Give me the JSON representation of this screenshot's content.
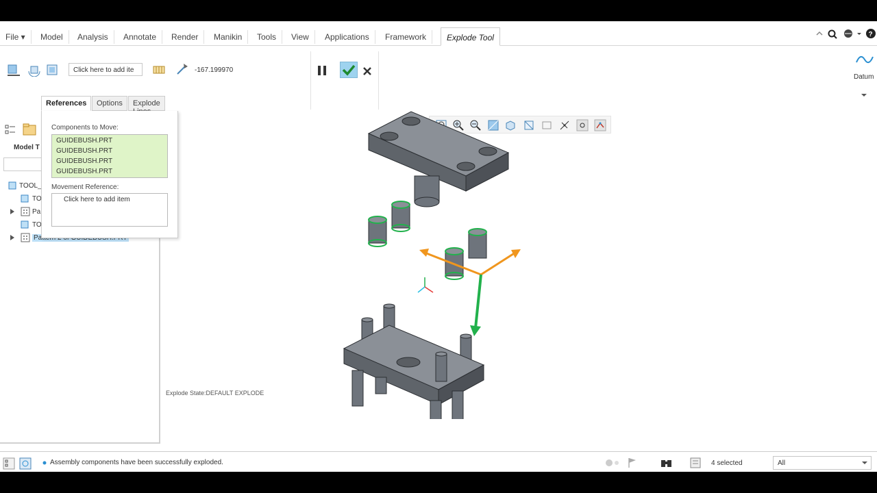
{
  "menubar": {
    "file": "File ▾",
    "items": [
      "Model",
      "Analysis",
      "Annotate",
      "Render",
      "Manikin",
      "Tools",
      "View",
      "Applications",
      "Framework"
    ],
    "active_tab": "Explode Tool"
  },
  "ribbon": {
    "add_item_placeholder": "Click here to add ite",
    "coordinate_value": "-167.199970",
    "datum_label": "Datum"
  },
  "dialog_tabs": [
    "References",
    "Options",
    "Explode Lines"
  ],
  "references": {
    "components_label": "Components to Move:",
    "components": [
      "GUIDEBUSH.PRT",
      "GUIDEBUSH.PRT",
      "GUIDEBUSH.PRT",
      "GUIDEBUSH.PRT"
    ],
    "movement_label": "Movement Reference:",
    "movement_placeholder": "Click here to add item"
  },
  "model_tree": {
    "title": "Model T",
    "items": [
      "TOOL_",
      "TO",
      "Pa",
      "TO",
      "Pattern 2 of GUIDEBUSH.PRT"
    ]
  },
  "graphics": {
    "explode_state": "Explode State:DEFAULT EXPLODE"
  },
  "status": {
    "message": "Assembly components have been successfully exploded.",
    "selected": "4 selected",
    "filter": "All"
  },
  "colors": {
    "accent_green": "#22b14c",
    "accent_orange": "#f0961e",
    "part_gray": "#6e747c",
    "selection_bg": "#dff4c8"
  }
}
